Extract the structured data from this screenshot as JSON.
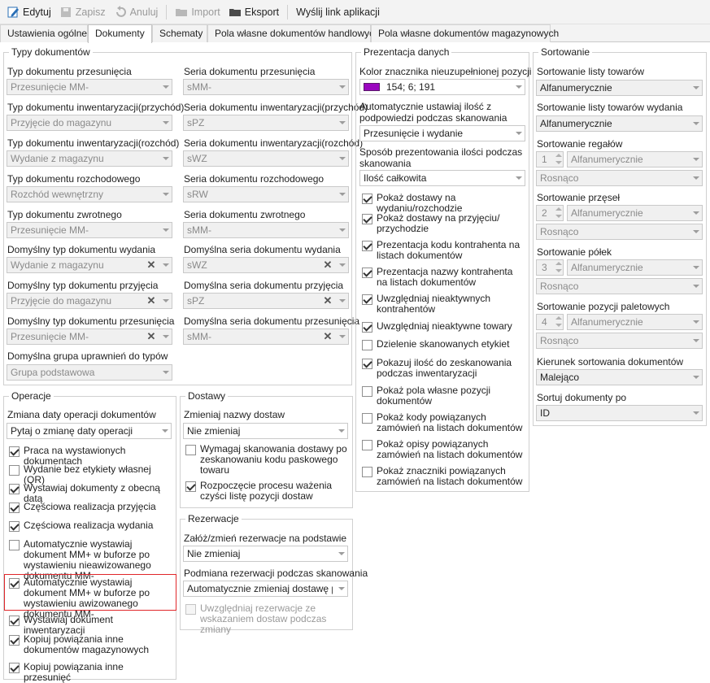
{
  "toolbar": {
    "edit": "Edytuj",
    "save": "Zapisz",
    "cancel": "Anuluj",
    "import": "Import",
    "export": "Eksport",
    "send_link": "Wyślij link aplikacji"
  },
  "tabs": [
    "Ustawienia ogólne",
    "Dokumenty",
    "Schematy",
    "Pola własne dokumentów handlowych",
    "Pola własne dokumentów magazynowych"
  ],
  "doc_types": {
    "title": "Typy dokumentów",
    "rows": [
      {
        "type_label": "Typ dokumentu przesunięcia",
        "type_value": "Przesunięcie MM-",
        "series_label": "Seria dokumentu przesunięcia",
        "series_value": "sMM-"
      },
      {
        "type_label": "Typ dokumentu inwentaryzacji(przychód)",
        "type_value": "Przyjęcie do magazynu",
        "series_label": "Seria dokumentu inwentaryzacji(przychód)",
        "series_value": "sPZ"
      },
      {
        "type_label": "Typ dokumentu inwentaryzacji(rozchód)",
        "type_value": "Wydanie z magazynu",
        "series_label": "Seria dokumentu inwentaryzacji(rozchód)",
        "series_value": "sWZ"
      },
      {
        "type_label": "Typ dokumentu rozchodowego",
        "type_value": "Rozchód wewnętrzny",
        "series_label": "Seria dokumentu rozchodowego",
        "series_value": "sRW"
      },
      {
        "type_label": "Typ dokumentu zwrotnego",
        "type_value": "Przesunięcie MM-",
        "series_label": "Seria dokumentu zwrotnego",
        "series_value": "sMM-"
      },
      {
        "type_label": "Domyślny typ dokumentu wydania",
        "type_value": "Wydanie z magazynu",
        "series_label": "Domyślna seria dokumentu wydania",
        "series_value": "sWZ"
      },
      {
        "type_label": "Domyślny typ dokumentu przyjęcia",
        "type_value": "Przyjęcie do magazynu",
        "series_label": "Domyślna seria dokumentu przyjęcia",
        "series_value": "sPZ"
      },
      {
        "type_label": "Domyślny typ dokumentu przesunięcia",
        "type_value": "Przesunięcie MM-",
        "series_label": "Domyślna seria dokumentu przesunięcia",
        "series_value": "sMM-"
      }
    ],
    "group_label": "Domyślna grupa uprawnień do typów",
    "group_value": "Grupa podstawowa"
  },
  "operations": {
    "title": "Operacje",
    "date_label": "Zmiana daty operacji dokumentów",
    "date_value": "Pytaj o zmianę daty operacji",
    "checks": [
      {
        "text": "Praca na wystawionych dokumentach",
        "checked": true
      },
      {
        "text": "Wydanie bez etykiety własnej (QR)",
        "checked": false
      },
      {
        "text": "Wystawiaj dokumenty z obecną datą",
        "checked": true
      },
      {
        "text": "Częściowa realizacja przyjęcia",
        "checked": true
      },
      {
        "text": "Częściowa realizacja wydania",
        "checked": true
      },
      {
        "text": "Automatycznie wystawiaj dokument MM+ w buforze po wystawieniu nieawizowanego dokumentu MM-",
        "checked": false
      },
      {
        "text": "Automatycznie wystawiaj dokument MM+ w buforze po wystawieniu awizowanego dokumentu MM-",
        "checked": true
      },
      {
        "text": "Wystawiaj dokument inwentaryzacji",
        "checked": true
      },
      {
        "text": "Kopiuj powiązania inne dokumentów magazynowych",
        "checked": true
      },
      {
        "text": "Kopiuj powiązania inne przesunięć",
        "checked": true
      }
    ]
  },
  "deliveries": {
    "title": "Dostawy",
    "name_label": "Zmieniaj nazwy dostaw",
    "name_value": "Nie zmieniaj",
    "checks": [
      {
        "text": "Wymagaj skanowania dostawy po zeskanowaniu kodu paskowego towaru",
        "checked": false
      },
      {
        "text": "Rozpoczęcie procesu ważenia czyści listę pozycji dostaw",
        "checked": true
      }
    ]
  },
  "reservations": {
    "title": "Rezerwacje",
    "create_label": "Załóż/zmień rezerwacje na podstawie",
    "create_value": "Nie zmieniaj",
    "scan_label": "Podmiana rezerwacji podczas skanowania",
    "scan_value": "Automatycznie zmieniaj dostawę po...",
    "check": {
      "text": "Uwzględniaj rezerwacje ze wskazaniem dostaw podczas zmiany",
      "checked": false
    }
  },
  "presentation": {
    "title": "Prezentacja danych",
    "color_label": "Kolor znacznika nieuzupełnionej pozycji",
    "color_value": "154; 6; 191",
    "color_hex": "#9a06bf",
    "auto_qty_label": "Automatycznie ustawiaj ilość z podpowiedzi podczas skanowania",
    "auto_qty_value": "Przesunięcie i wydanie",
    "qty_mode_label": "Sposób prezentowania ilości podczas skanowania",
    "qty_mode_value": "Ilość całkowita",
    "checks": [
      {
        "text": "Pokaż dostawy na wydaniu/rozchodzie",
        "checked": true
      },
      {
        "text": "Pokaż dostawy na przyjęciu/ przychodzie",
        "checked": true
      },
      {
        "text": "Prezentacja kodu kontrahenta na listach dokumentów",
        "checked": true
      },
      {
        "text": "Prezentacja nazwy kontrahenta na listach dokumentów",
        "checked": true
      },
      {
        "text": "Uwzględniaj nieaktywnych kontrahentów",
        "checked": true
      },
      {
        "text": "Uwzględniaj nieaktywne towary",
        "checked": true
      },
      {
        "text": "Dzielenie skanowanych etykiet",
        "checked": false
      },
      {
        "text": "Pokazuj ilość do zeskanowania podczas inwentaryzacji",
        "checked": true
      },
      {
        "text": "Pokaż pola własne pozycji dokumentów",
        "checked": false
      },
      {
        "text": "Pokaż kody powiązanych zamówień na listach dokumentów",
        "checked": false
      },
      {
        "text": "Pokaż opisy powiązanych zamówień na listach dokumentów",
        "checked": false
      },
      {
        "text": "Pokaż znaczniki powiązanych zamówień na listach dokumentów",
        "checked": false
      }
    ]
  },
  "sorting": {
    "title": "Sortowanie",
    "products_label": "Sortowanie listy towarów",
    "products_value": "Alfanumerycznie",
    "products_issue_label": "Sortowanie listy towarów wydania",
    "products_issue_value": "Alfanumerycznie",
    "levels": [
      {
        "label": "Sortowanie regałów",
        "num": "1",
        "mode": "Alfanumerycznie",
        "dir": "Rosnąco"
      },
      {
        "label": "Sortowanie przęseł",
        "num": "2",
        "mode": "Alfanumerycznie",
        "dir": "Rosnąco"
      },
      {
        "label": "Sortowanie półek",
        "num": "3",
        "mode": "Alfanumerycznie",
        "dir": "Rosnąco"
      },
      {
        "label": "Sortowanie pozycji paletowych",
        "num": "4",
        "mode": "Alfanumerycznie",
        "dir": "Rosnąco"
      }
    ],
    "direction_label": "Kierunek sortowania dokumentów",
    "direction_value": "Malejąco",
    "sort_by_label": "Sortuj dokumenty po",
    "sort_by_value": "ID"
  }
}
